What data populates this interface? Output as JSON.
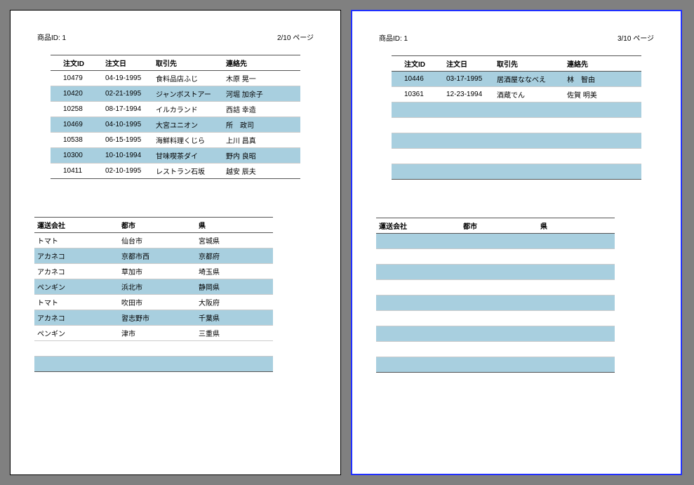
{
  "pages": [
    {
      "product_label": "商品ID: 1",
      "page_label": "2/10 ページ",
      "orders_header": {
        "id": "注文ID",
        "date": "注文日",
        "customer": "取引先",
        "contact": "連絡先"
      },
      "orders": [
        {
          "id": "10479",
          "date": "04-19-1995",
          "customer": "食料品店ふじ",
          "contact": "木原 晃一"
        },
        {
          "id": "10420",
          "date": "02-21-1995",
          "customer": "ジャンボストアー",
          "contact": "河堀 加余子"
        },
        {
          "id": "10258",
          "date": "08-17-1994",
          "customer": "イルカランド",
          "contact": "西詰 幸造"
        },
        {
          "id": "10469",
          "date": "04-10-1995",
          "customer": "大宮ユニオン",
          "contact": "所　政司"
        },
        {
          "id": "10538",
          "date": "06-15-1995",
          "customer": "海鮮料理くじら",
          "contact": "上川 昌真"
        },
        {
          "id": "10300",
          "date": "10-10-1994",
          "customer": "甘味喫茶ダイ",
          "contact": "野内 良昭"
        },
        {
          "id": "10411",
          "date": "02-10-1995",
          "customer": "レストラン石坂",
          "contact": "越安 辰夫"
        }
      ],
      "ship_header": {
        "carrier": "運送会社",
        "city": "都市",
        "pref": "県"
      },
      "shipping": [
        {
          "carrier": "トマト",
          "city": "仙台市",
          "pref": "宮城県"
        },
        {
          "carrier": "アカネコ",
          "city": "京都市西",
          "pref": "京都府"
        },
        {
          "carrier": "アカネコ",
          "city": "草加市",
          "pref": "埼玉県"
        },
        {
          "carrier": "ペンギン",
          "city": "浜北市",
          "pref": "静岡県"
        },
        {
          "carrier": "トマト",
          "city": "吹田市",
          "pref": "大阪府"
        },
        {
          "carrier": "アカネコ",
          "city": "習志野市",
          "pref": "千葉県"
        },
        {
          "carrier": "ペンギン",
          "city": "津市",
          "pref": "三重県"
        },
        {
          "carrier": "",
          "city": "",
          "pref": ""
        },
        {
          "carrier": "",
          "city": "",
          "pref": ""
        }
      ]
    },
    {
      "product_label": "商品ID: 1",
      "page_label": "3/10 ページ",
      "orders_header": {
        "id": "注文ID",
        "date": "注文日",
        "customer": "取引先",
        "contact": "連絡先"
      },
      "orders": [
        {
          "id": "10446",
          "date": "03-17-1995",
          "customer": "居酒屋ななべえ",
          "contact": "林　智由"
        },
        {
          "id": "10361",
          "date": "12-23-1994",
          "customer": "酒蔵でん",
          "contact": "佐賀 明美"
        },
        {
          "id": "",
          "date": "",
          "customer": "",
          "contact": ""
        },
        {
          "id": "",
          "date": "",
          "customer": "",
          "contact": ""
        },
        {
          "id": "",
          "date": "",
          "customer": "",
          "contact": ""
        },
        {
          "id": "",
          "date": "",
          "customer": "",
          "contact": ""
        },
        {
          "id": "",
          "date": "",
          "customer": "",
          "contact": ""
        }
      ],
      "ship_header": {
        "carrier": "運送会社",
        "city": "都市",
        "pref": "県"
      },
      "shipping": [
        {
          "carrier": "",
          "city": "",
          "pref": ""
        },
        {
          "carrier": "",
          "city": "",
          "pref": ""
        },
        {
          "carrier": "",
          "city": "",
          "pref": ""
        },
        {
          "carrier": "",
          "city": "",
          "pref": ""
        },
        {
          "carrier": "",
          "city": "",
          "pref": ""
        },
        {
          "carrier": "",
          "city": "",
          "pref": ""
        },
        {
          "carrier": "",
          "city": "",
          "pref": ""
        },
        {
          "carrier": "",
          "city": "",
          "pref": ""
        },
        {
          "carrier": "",
          "city": "",
          "pref": ""
        }
      ]
    }
  ]
}
